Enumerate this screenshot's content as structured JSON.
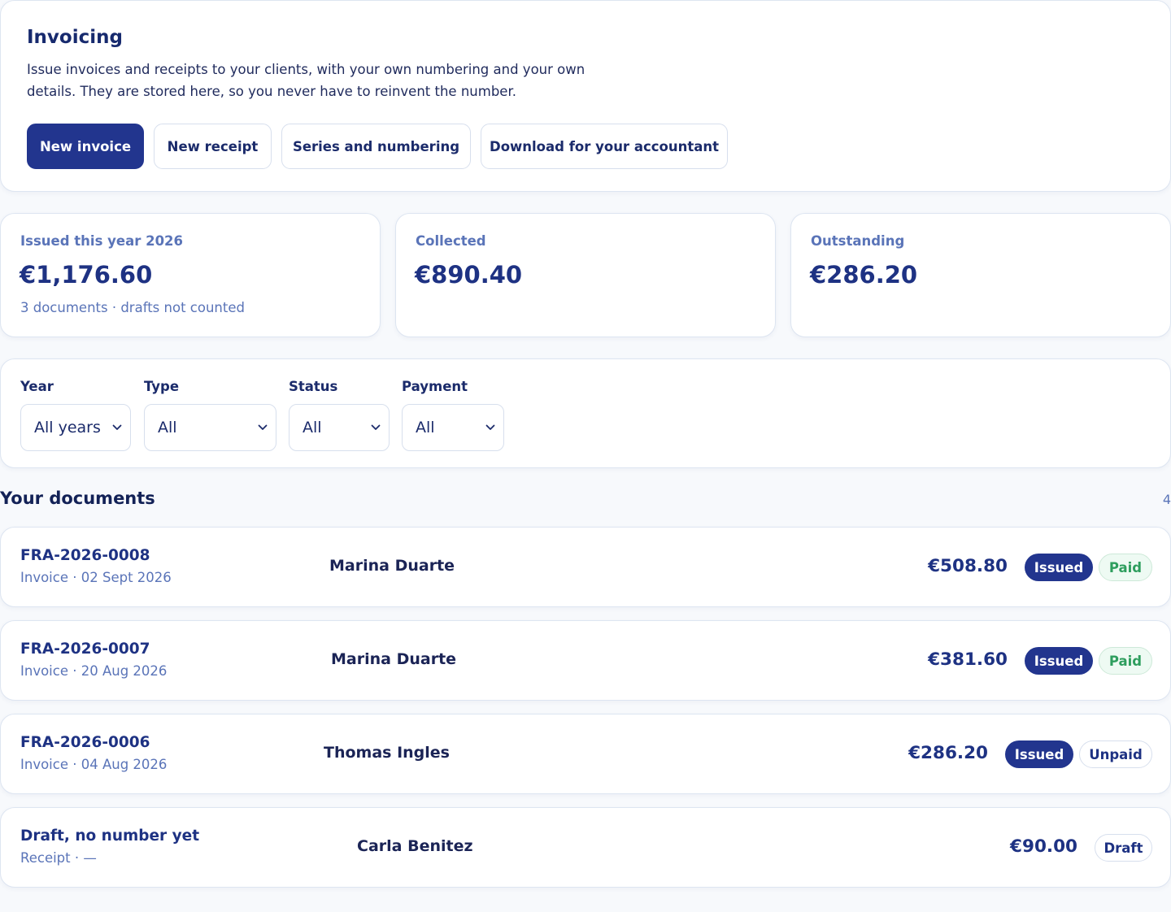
{
  "header": {
    "title": "Invoicing",
    "description": "Issue invoices and receipts to your clients, with your own numbering and your own details. They are stored here, so you never have to reinvent the number.",
    "buttons": {
      "new_invoice": "New invoice",
      "new_receipt": "New receipt",
      "series": "Series and numbering",
      "download": "Download for your accountant"
    }
  },
  "stats": {
    "issued": {
      "label": "Issued this year 2026",
      "value": "€1,176.60",
      "note": "3 documents · drafts not counted"
    },
    "collected": {
      "label": "Collected",
      "value": "€890.40"
    },
    "outstanding": {
      "label": "Outstanding",
      "value": "€286.20"
    }
  },
  "filters": {
    "year": {
      "label": "Year",
      "value": "All years"
    },
    "type": {
      "label": "Type",
      "value": "All"
    },
    "status": {
      "label": "Status",
      "value": "All"
    },
    "payment": {
      "label": "Payment",
      "value": "All"
    }
  },
  "documents": {
    "heading": "Your documents",
    "count": "4",
    "rows": [
      {
        "number": "FRA-2026-0008",
        "subtitle": "Invoice · 02 Sept 2026",
        "client": "Marina Duarte",
        "amount": "€508.80",
        "status": "Issued",
        "payment": "Paid"
      },
      {
        "number": "FRA-2026-0007",
        "subtitle": "Invoice · 20 Aug 2026",
        "client": "Marina Duarte",
        "amount": "€381.60",
        "status": "Issued",
        "payment": "Paid"
      },
      {
        "number": "FRA-2026-0006",
        "subtitle": "Invoice · 04 Aug 2026",
        "client": "Thomas Ingles",
        "amount": "€286.20",
        "status": "Issued",
        "payment": "Unpaid"
      },
      {
        "number": "Draft, no number yet",
        "subtitle": "Receipt · —",
        "client": "Carla Benitez",
        "amount": "€90.00",
        "status": "Draft"
      }
    ]
  },
  "colors": {
    "primary": "#22358e",
    "accent_text": "#5a74b8",
    "paid_green": "#2e9e5e",
    "background": "#f7f9fc"
  }
}
